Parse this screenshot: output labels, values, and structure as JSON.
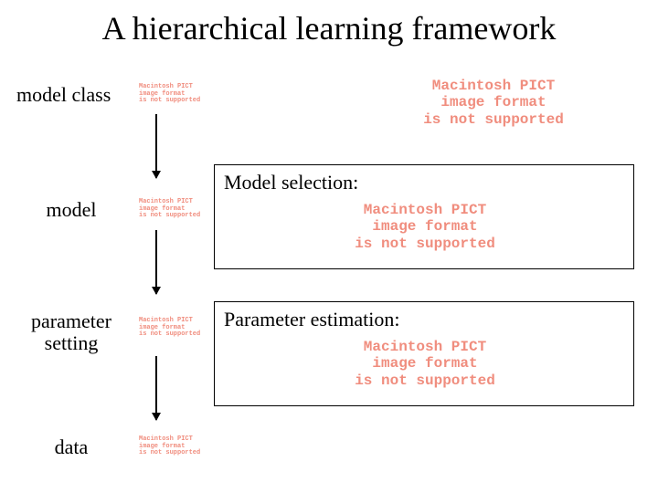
{
  "title": "A hierarchical learning framework",
  "levels": {
    "model_class": "model class",
    "model": "model",
    "parameter_setting_line1": "parameter",
    "parameter_setting_line2": "setting",
    "data": "data"
  },
  "boxes": {
    "model_selection": "Model selection:",
    "parameter_estimation": "Parameter estimation:"
  },
  "placeholder": {
    "line1": "Macintosh PICT",
    "line2": "image format",
    "line3": "is not supported"
  }
}
